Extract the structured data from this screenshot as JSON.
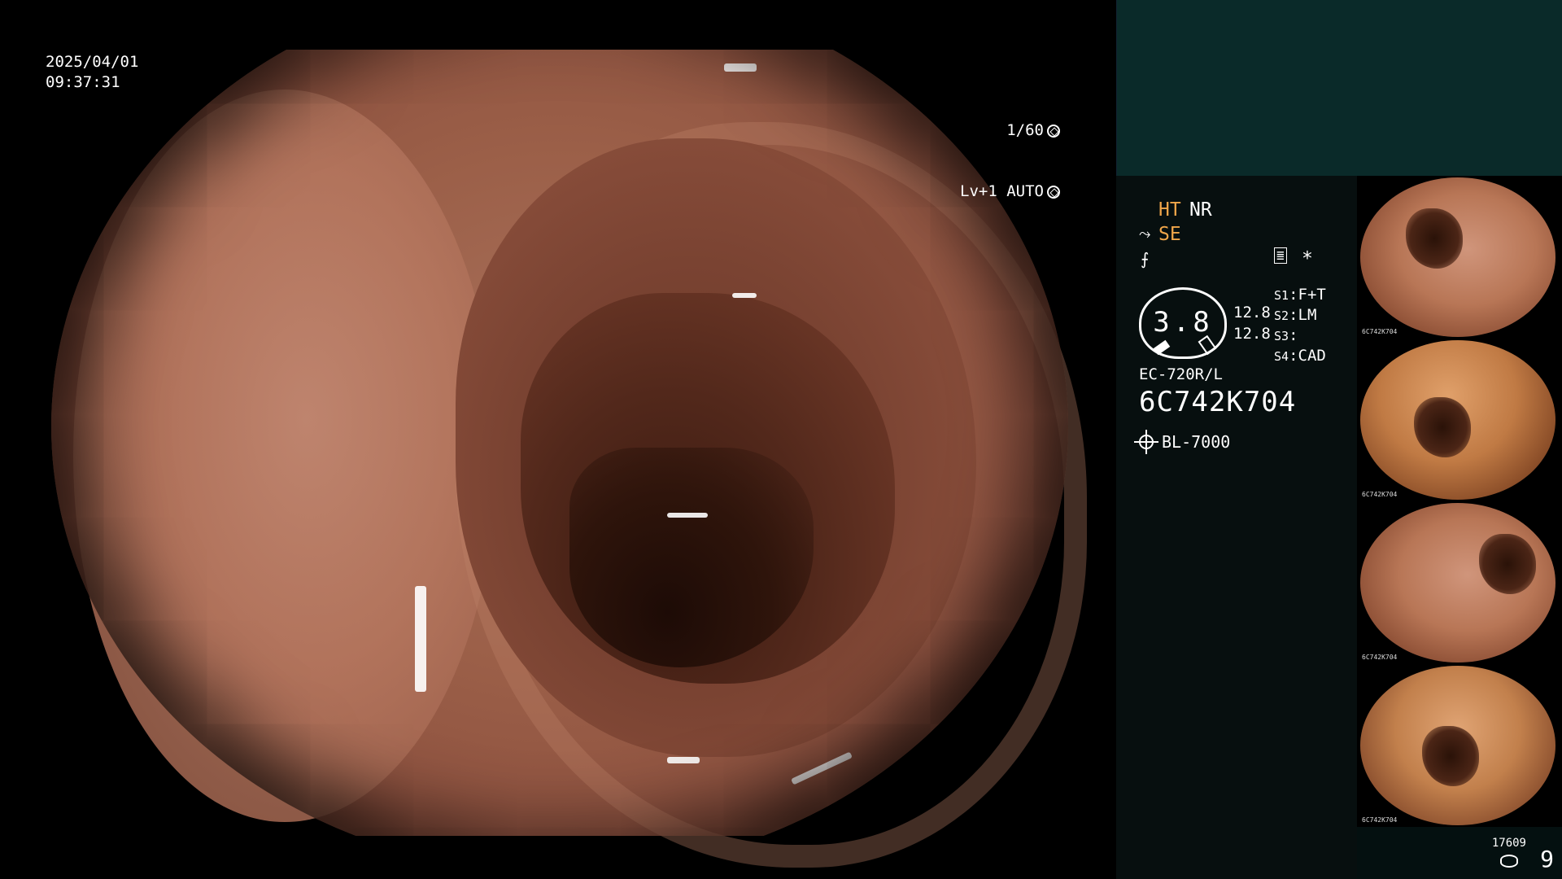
{
  "overlay": {
    "date": "2025/04/01",
    "time": "09:37:31",
    "shutter": "1/60",
    "exposure": "Lv+1 AUTO",
    "shutter_icon": "aperture-icon",
    "exposure_icon": "iris-icon"
  },
  "settings": {
    "ht": "HT",
    "nr": "NR",
    "se": "SE",
    "gauge_value": "3.8",
    "level_1": "12.8",
    "level_2": "12.8",
    "scope_model": "EC-720R/L",
    "scope_serial": "6C742K704",
    "light_source": "BL-7000",
    "asterisk": "*"
  },
  "switches": [
    {
      "key": "S1",
      "value": "F+T"
    },
    {
      "key": "S2",
      "value": "LM"
    },
    {
      "key": "S3",
      "value": ""
    },
    {
      "key": "S4",
      "value": "CAD"
    }
  ],
  "thumbnails": [
    {
      "caption": "6C742K704"
    },
    {
      "caption": "6C742K704"
    },
    {
      "caption": "6C742K704"
    },
    {
      "caption": "6C742K704"
    }
  ],
  "footer": {
    "storage_count": "17609",
    "image_count": "9"
  },
  "colors": {
    "panel_top": "#0a2a29",
    "panel_bg": "#070f0f",
    "accent_orange": "#f0a64a"
  }
}
